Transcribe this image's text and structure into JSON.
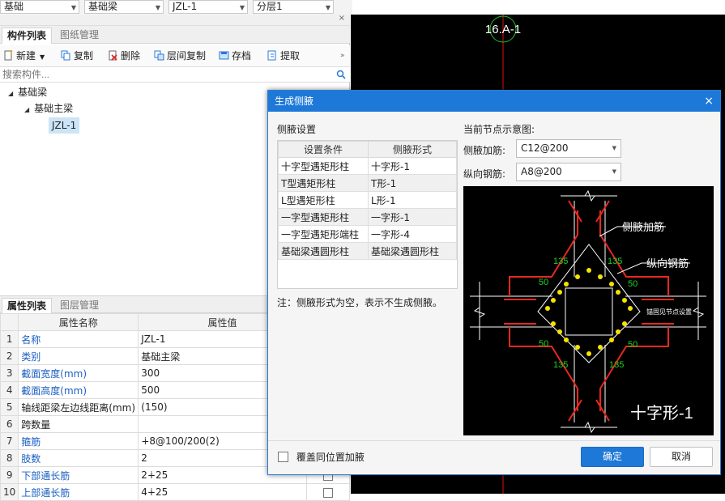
{
  "topbar": {
    "selectors": [
      "基础",
      "基础梁",
      "JZL-1",
      "分层1"
    ]
  },
  "left_panel": {
    "close_icon": "×",
    "tabs": [
      "构件列表",
      "图纸管理"
    ],
    "toolbar": {
      "new": "新建",
      "copy": "复制",
      "delete": "删除",
      "floor_copy": "层间复制",
      "save": "存档",
      "extract": "提取"
    },
    "search_placeholder": "搜索构件...",
    "tree": {
      "root": "基础梁",
      "child": "基础主梁",
      "leaf": "JZL-1"
    }
  },
  "properties": {
    "tabs": [
      "属性列表",
      "图层管理"
    ],
    "headers": [
      "属性名称",
      "属性值"
    ],
    "rows": [
      {
        "num": "1",
        "name": "名称",
        "value": "JZL-1",
        "blue": true
      },
      {
        "num": "2",
        "name": "类别",
        "value": "基础主梁",
        "blue": true
      },
      {
        "num": "3",
        "name": "截面宽度(mm)",
        "value": "300",
        "blue": true
      },
      {
        "num": "4",
        "name": "截面高度(mm)",
        "value": "500",
        "blue": true
      },
      {
        "num": "5",
        "name": "轴线距梁左边线距离(mm)",
        "value": "(150)",
        "blue": false
      },
      {
        "num": "6",
        "name": "跨数量",
        "value": "",
        "blue": false
      },
      {
        "num": "7",
        "name": "箍筋",
        "value": "∔8@100/200(2)",
        "blue": true
      },
      {
        "num": "8",
        "name": "肢数",
        "value": "2",
        "blue": true
      },
      {
        "num": "9",
        "name": "下部通长筋",
        "value": "2∔25",
        "blue": true
      },
      {
        "num": "10",
        "name": "上部通长筋",
        "value": "4∔25",
        "blue": true
      }
    ]
  },
  "canvas": {
    "axis_label": "16.A-1"
  },
  "dialog": {
    "title": "生成侧腋",
    "close": "×",
    "section_label": "侧腋设置",
    "grid_headers": [
      "设置条件",
      "侧腋形式"
    ],
    "grid_rows": [
      [
        "十字型遇矩形柱",
        "十字形-1"
      ],
      [
        "T型遇矩形柱",
        "T形-1"
      ],
      [
        "L型遇矩形柱",
        "L形-1"
      ],
      [
        "一字型遇矩形柱",
        "一字形-1"
      ],
      [
        "一字型遇矩形端柱",
        "一字形-4"
      ],
      [
        "基础梁遇圆形柱",
        "基础梁遇圆形柱"
      ]
    ],
    "note": "注：侧腋形式为空，表示不生成侧腋。",
    "diagram_label": "当前节点示意图:",
    "haunch_rebar_label": "侧腋加筋:",
    "haunch_rebar_value": "C12@200",
    "long_rebar_label": "纵向钢筋:",
    "long_rebar_value": "A8@200",
    "preview": {
      "label_haunch": "侧腋加筋",
      "label_long": "纵向钢筋",
      "label_anchor": "锚固见节点设置",
      "dim_135": "135",
      "dim_50": "50",
      "shape_name": "十字形-1"
    },
    "overwrite_label": "覆盖同位置加腋",
    "ok": "确定",
    "cancel": "取消"
  },
  "colors": {
    "accent": "#1e78d8",
    "rebar_red": "#e8281e",
    "dim_green": "#22d022",
    "dot_yellow": "#f5e400"
  }
}
